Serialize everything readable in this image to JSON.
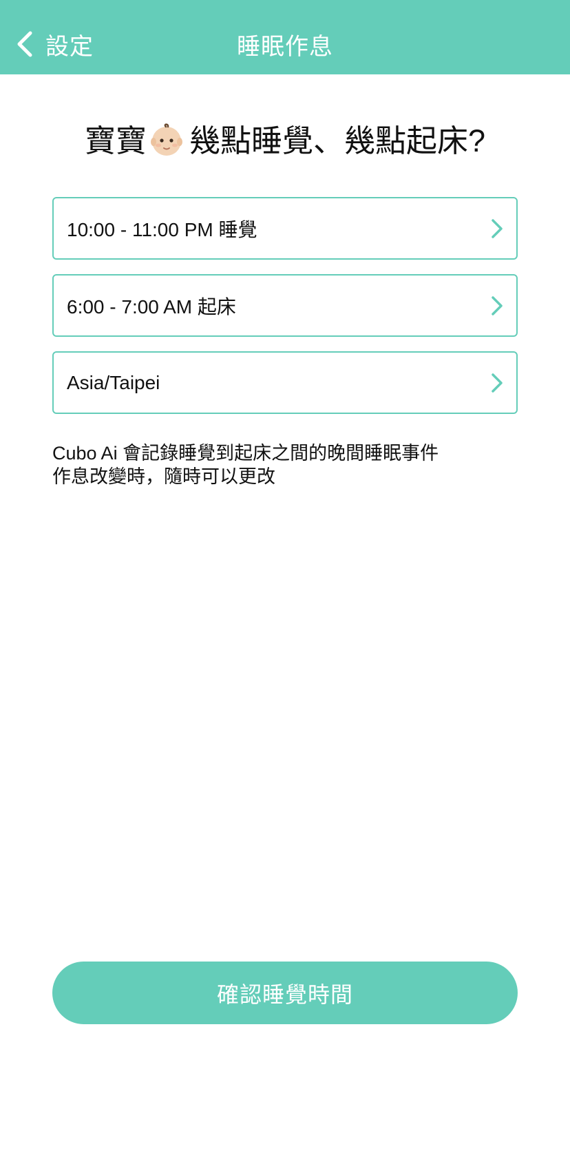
{
  "header": {
    "back_label": "設定",
    "title": "睡眠作息"
  },
  "question": {
    "prefix": "寶寶",
    "emoji_icon": "baby-face-icon",
    "suffix": "幾點睡覺、幾點起床?"
  },
  "options": [
    {
      "label": "10:00 - 11:00 PM 睡覺"
    },
    {
      "label": "6:00 - 7:00 AM 起床"
    },
    {
      "label": "Asia/Taipei"
    }
  ],
  "note": {
    "line1": "Cubo Ai 會記錄睡覺到起床之間的晚間睡眠事件",
    "line2": "作息改變時，隨時可以更改"
  },
  "confirm_label": "確認睡覺時間",
  "colors": {
    "accent": "#64cdb9",
    "background": "#ffffff",
    "text": "#111111"
  }
}
